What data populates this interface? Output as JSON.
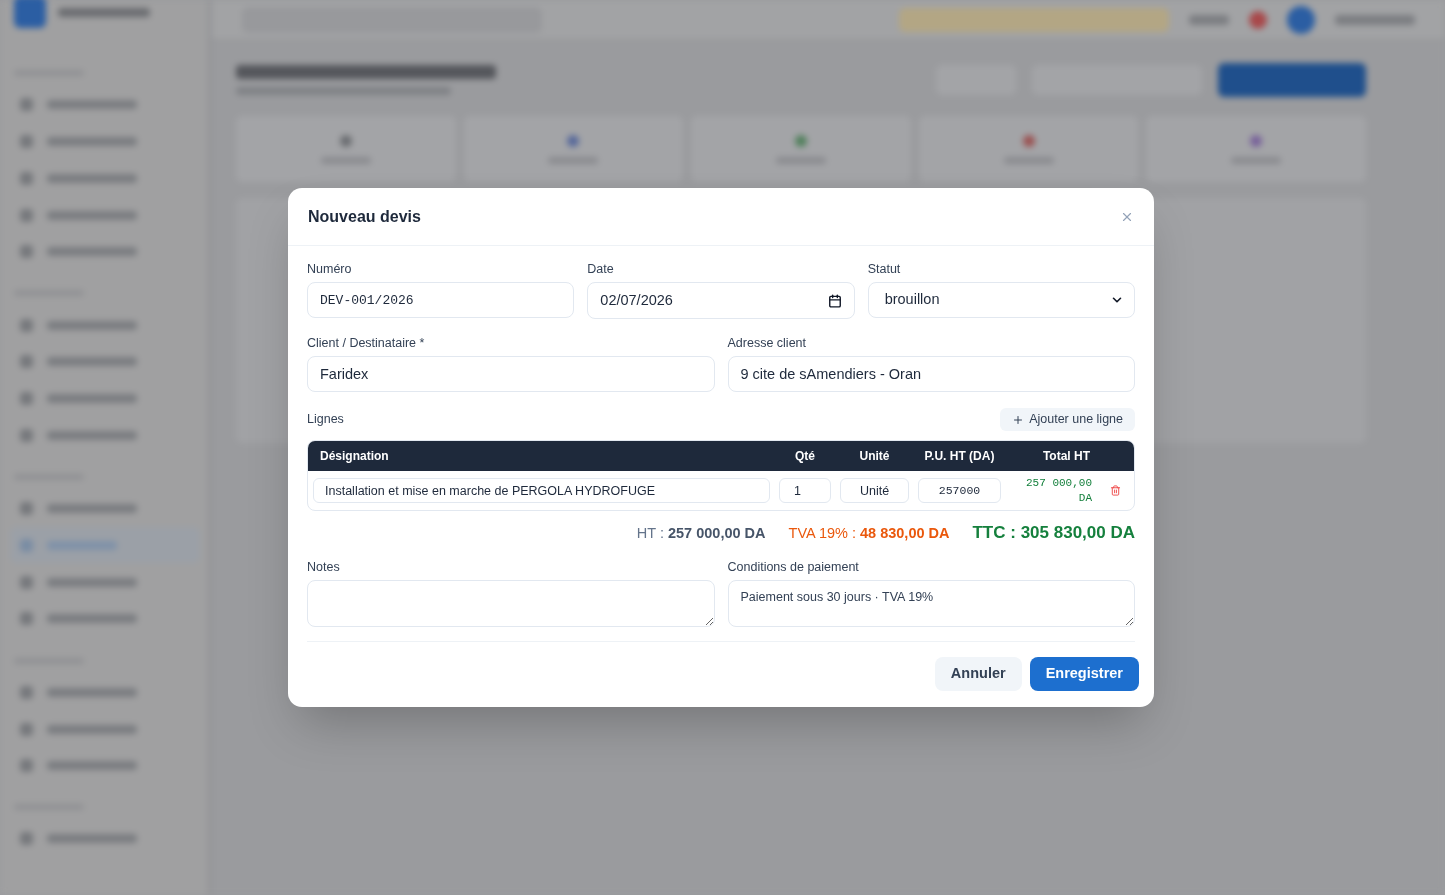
{
  "dialog": {
    "title": "Nouveau devis",
    "field_rows": [
      [
        {
          "kind": "mono",
          "label": "Numéro",
          "value": "DEV-001/2026"
        },
        {
          "kind": "date",
          "label": "Date",
          "value": "02/07/2026"
        },
        {
          "kind": "select",
          "label": "Statut",
          "value": "brouillon"
        }
      ],
      [
        {
          "kind": "text",
          "label": "Client / Destinataire *",
          "value": "Faridex"
        },
        {
          "kind": "text",
          "label": "Adresse client",
          "value": "9 cite de sAmendiers - Oran"
        }
      ]
    ],
    "lines": {
      "label": "Lignes",
      "add_button": "Ajouter une ligne",
      "columns": [
        "Désignation",
        "Qté",
        "Unité",
        "P.U. HT (DA)",
        "Total HT"
      ],
      "rows": [
        {
          "designation": "Installation et mise en marche de PERGOLA HYDROFUGE",
          "quantity": "1",
          "unit": "Unité",
          "unit_price": "257000",
          "total": "257 000,00 DA"
        }
      ]
    },
    "totals": [
      {
        "kind": "ht",
        "text": "HT : **257 000,00 DA**"
      },
      {
        "kind": "tva",
        "text": "TVA 19% : **48 830,00 DA**"
      },
      {
        "kind": "ttc",
        "text": "TTC : 305 830,00 DA"
      }
    ],
    "notes": {
      "label": "Notes"
    },
    "payment_terms": {
      "label": "Conditions de paiement",
      "value": "Paiement sous 30 jours · TVA 19%"
    },
    "buttons": [
      {
        "kind": "secondary",
        "label": "Annuler"
      },
      {
        "kind": "primary",
        "label": "Enregistrer"
      }
    ]
  }
}
